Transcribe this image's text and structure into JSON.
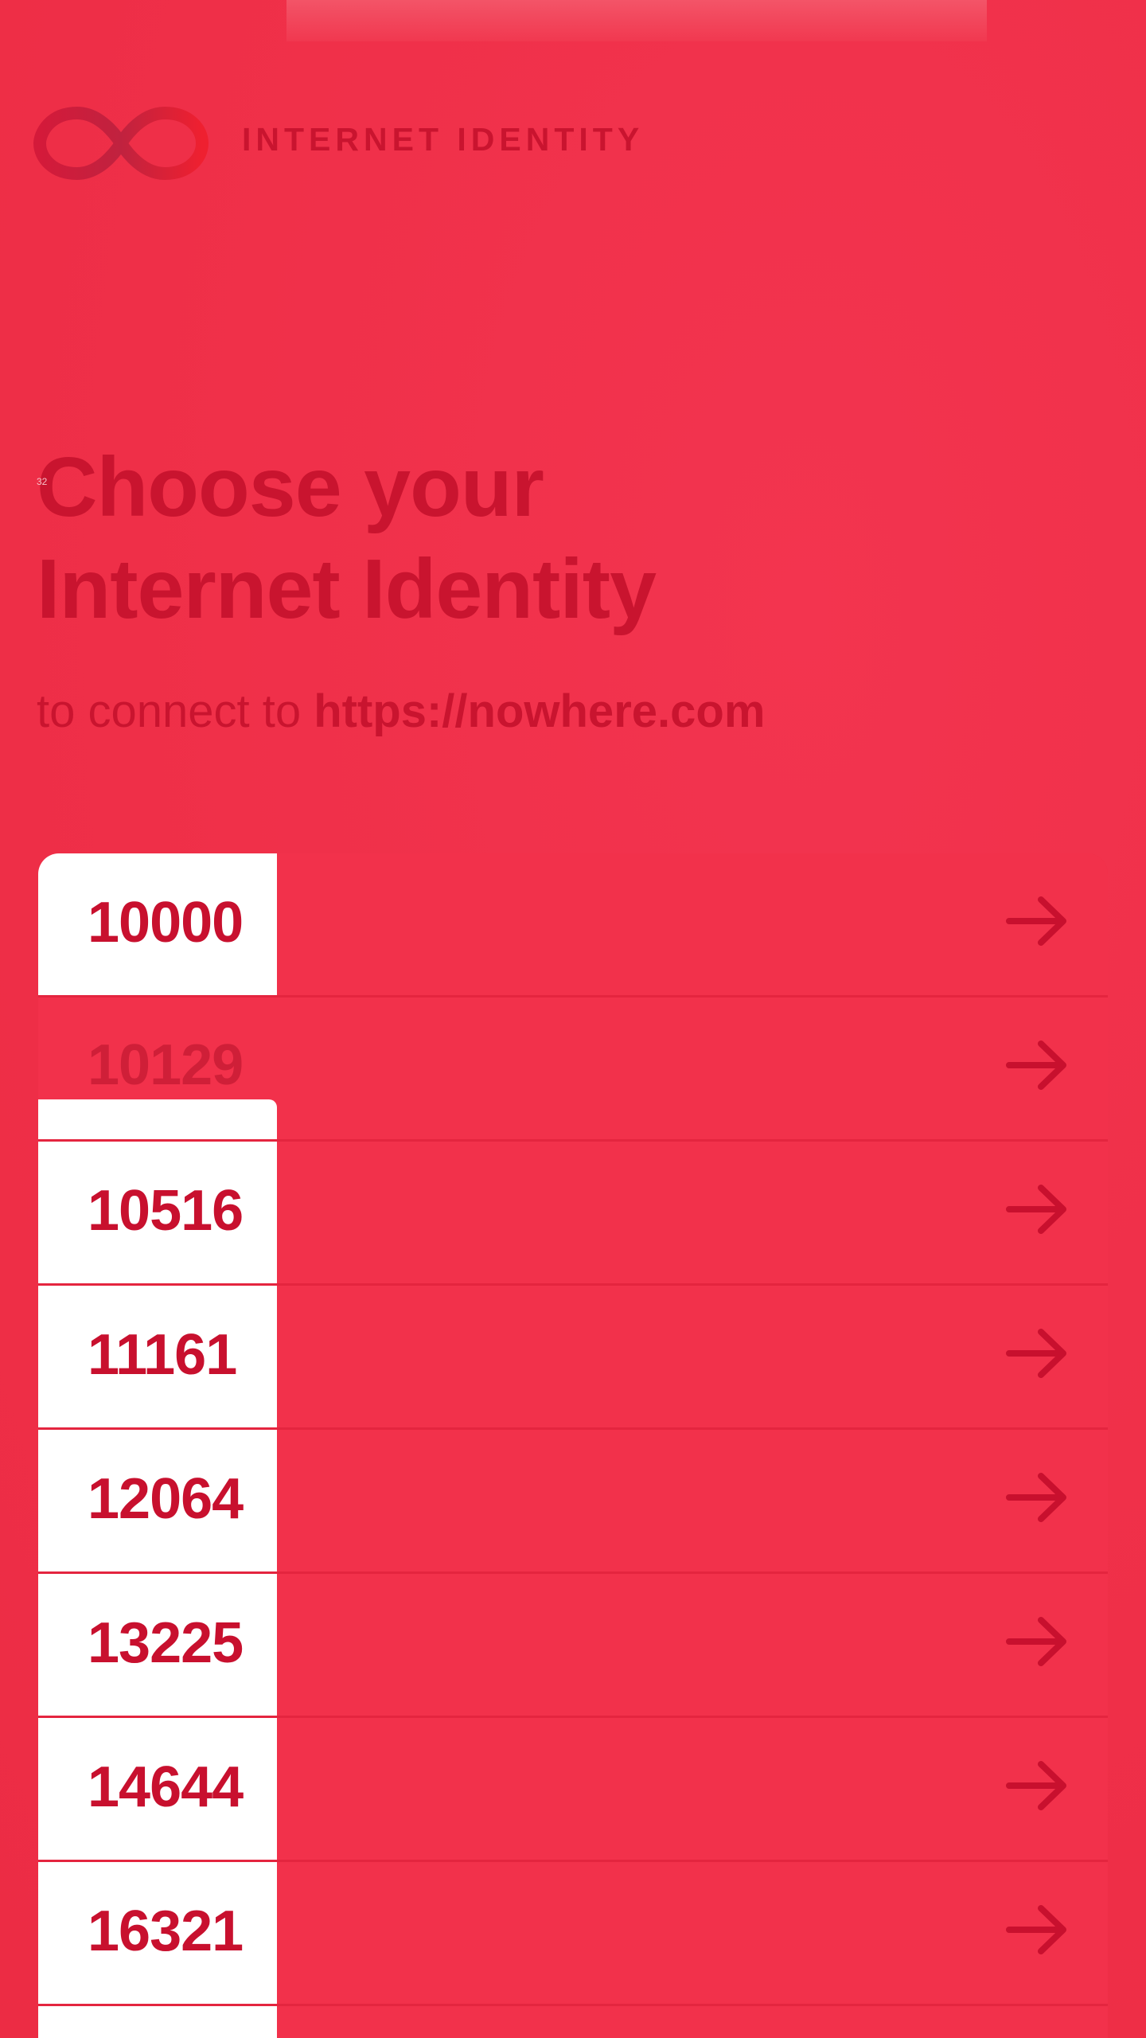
{
  "brand": {
    "name": "INTERNET IDENTITY"
  },
  "tag": "32",
  "heading": {
    "line1": "Choose your",
    "line2": "Internet Identity"
  },
  "subtitle": {
    "prefix": "to connect to",
    "url": "https://nowhere.com"
  },
  "identities": [
    {
      "number": "10000",
      "icon": "arrow-right-icon"
    },
    {
      "number": "10129",
      "icon": "arrow-right-icon"
    },
    {
      "number": "10516",
      "icon": "arrow-right-icon"
    },
    {
      "number": "11161",
      "icon": "arrow-right-icon"
    },
    {
      "number": "12064",
      "icon": "arrow-right-icon"
    },
    {
      "number": "13225",
      "icon": "arrow-right-icon"
    },
    {
      "number": "14644",
      "icon": "arrow-right-icon"
    },
    {
      "number": "16321",
      "icon": "arrow-right-icon"
    }
  ],
  "colors": {
    "background": "#f0304a",
    "accent": "#c8102e",
    "card": "#ffffff"
  }
}
